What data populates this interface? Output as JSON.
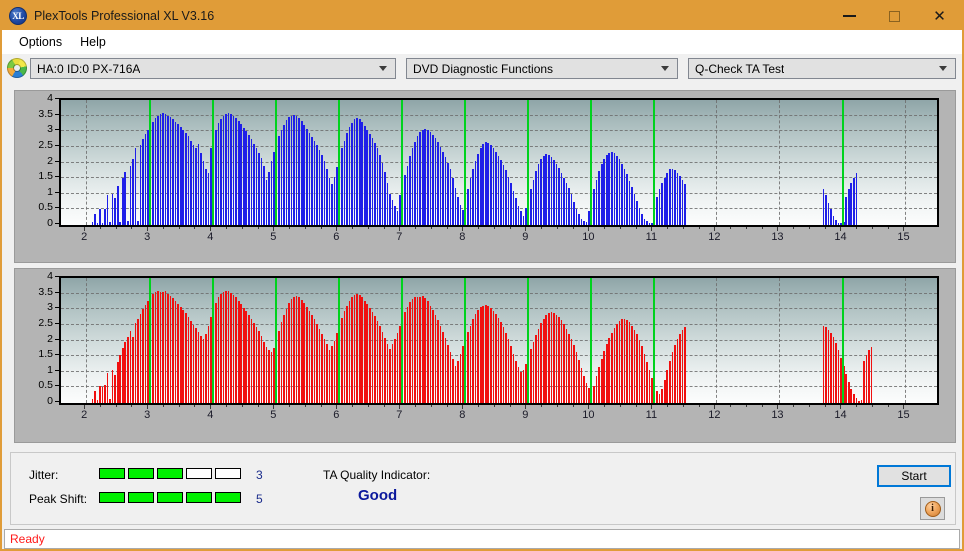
{
  "window": {
    "title": "PlexTools Professional XL V3.16",
    "app_icon": "xl-logo-icon",
    "minimize_label": "Minimize",
    "maximize_label": "Maximize",
    "close_label": "Close",
    "close_glyph": "✕"
  },
  "menubar": {
    "items": [
      {
        "label": "Options"
      },
      {
        "label": "Help"
      }
    ]
  },
  "toolbar": {
    "drive_icon": "optical-disc-icon",
    "drive_combo": {
      "value": "HA:0 ID:0  PX-716A",
      "options": [
        "HA:0 ID:0  PX-716A"
      ]
    },
    "function_combo": {
      "value": "DVD Diagnostic Functions",
      "options": [
        "DVD Diagnostic Functions"
      ]
    },
    "test_combo": {
      "value": "Q-Check TA Test",
      "options": [
        "Q-Check TA Test"
      ]
    }
  },
  "results": {
    "jitter_label": "Jitter:",
    "jitter_value": "3",
    "jitter_filled": 3,
    "jitter_total": 5,
    "peak_shift_label": "Peak Shift:",
    "peak_shift_value": "5",
    "peak_shift_filled": 5,
    "peak_shift_total": 5,
    "ta_quality_label": "TA Quality Indicator:",
    "ta_quality_value": "Good",
    "ta_quality_color": "#0b189c",
    "meter_on_color": "#00f000",
    "start_label": "Start",
    "info_icon": "info-icon"
  },
  "statusbar": {
    "text": "Ready",
    "color": "#ff1a1a"
  },
  "chart_data": [
    {
      "id": "jitter-chart",
      "type": "bar",
      "title": "",
      "xlabel": "",
      "ylabel": "",
      "color": "#1f1fe8",
      "xlim": [
        1.6,
        15.5
      ],
      "ylim": [
        0,
        4
      ],
      "yticks": [
        0,
        0.5,
        1,
        1.5,
        2,
        2.5,
        3,
        3.5,
        4
      ],
      "ytick_labels": [
        "0",
        "0.5",
        "1",
        "1.5",
        "2",
        "2.5",
        "3",
        "3.5",
        "4"
      ],
      "xticks": [
        2,
        3,
        4,
        5,
        6,
        7,
        8,
        9,
        10,
        11,
        12,
        13,
        14,
        15
      ],
      "xtick_labels": [
        "2",
        "3",
        "4",
        "5",
        "6",
        "7",
        "8",
        "9",
        "10",
        "11",
        "12",
        "13",
        "14",
        "15"
      ],
      "grid": true,
      "markers": [
        3,
        4,
        5,
        6,
        7,
        8,
        9,
        10,
        11,
        14
      ],
      "marker_color": "#00d21e",
      "x": [
        2.1,
        2.14,
        2.18,
        2.22,
        2.26,
        2.3,
        2.34,
        2.38,
        2.42,
        2.46,
        2.5,
        2.54,
        2.58,
        2.62,
        2.66,
        2.7,
        2.74,
        2.78,
        2.82,
        2.86,
        2.9,
        2.94,
        2.98,
        3.02,
        3.06,
        3.1,
        3.14,
        3.18,
        3.22,
        3.26,
        3.3,
        3.34,
        3.38,
        3.42,
        3.46,
        3.5,
        3.54,
        3.58,
        3.62,
        3.66,
        3.7,
        3.74,
        3.78,
        3.82,
        3.86,
        3.9,
        3.94,
        3.98,
        4.02,
        4.06,
        4.1,
        4.14,
        4.18,
        4.22,
        4.26,
        4.3,
        4.34,
        4.38,
        4.42,
        4.46,
        4.5,
        4.54,
        4.58,
        4.62,
        4.66,
        4.7,
        4.74,
        4.78,
        4.82,
        4.86,
        4.9,
        4.94,
        4.98,
        5.02,
        5.06,
        5.1,
        5.14,
        5.18,
        5.22,
        5.26,
        5.3,
        5.34,
        5.38,
        5.42,
        5.46,
        5.5,
        5.54,
        5.58,
        5.62,
        5.66,
        5.7,
        5.74,
        5.78,
        5.82,
        5.86,
        5.9,
        5.94,
        5.98,
        6.02,
        6.06,
        6.1,
        6.14,
        6.18,
        6.22,
        6.26,
        6.3,
        6.34,
        6.38,
        6.42,
        6.46,
        6.5,
        6.54,
        6.58,
        6.62,
        6.66,
        6.7,
        6.74,
        6.78,
        6.82,
        6.86,
        6.9,
        6.94,
        6.98,
        7.02,
        7.06,
        7.1,
        7.14,
        7.18,
        7.22,
        7.26,
        7.3,
        7.34,
        7.38,
        7.42,
        7.46,
        7.5,
        7.54,
        7.58,
        7.62,
        7.66,
        7.7,
        7.74,
        7.78,
        7.82,
        7.86,
        7.9,
        7.94,
        7.98,
        8.02,
        8.06,
        8.1,
        8.14,
        8.18,
        8.22,
        8.26,
        8.3,
        8.34,
        8.38,
        8.42,
        8.46,
        8.5,
        8.54,
        8.58,
        8.62,
        8.66,
        8.7,
        8.74,
        8.78,
        8.82,
        8.86,
        8.9,
        8.94,
        8.98,
        9.02,
        9.06,
        9.1,
        9.14,
        9.18,
        9.22,
        9.26,
        9.3,
        9.34,
        9.38,
        9.42,
        9.46,
        9.5,
        9.54,
        9.58,
        9.62,
        9.66,
        9.7,
        9.74,
        9.78,
        9.82,
        9.86,
        9.9,
        9.94,
        9.98,
        10.02,
        10.06,
        10.1,
        10.14,
        10.18,
        10.22,
        10.26,
        10.3,
        10.34,
        10.38,
        10.42,
        10.46,
        10.5,
        10.54,
        10.58,
        10.62,
        10.66,
        10.7,
        10.74,
        10.78,
        10.82,
        10.86,
        10.9,
        10.94,
        10.98,
        11.02,
        11.06,
        11.1,
        11.14,
        11.18,
        11.22,
        11.26,
        11.3,
        11.34,
        11.38,
        11.42,
        11.46,
        11.5,
        13.7,
        13.74,
        13.78,
        13.82,
        13.86,
        13.9,
        13.94,
        13.98,
        14.02,
        14.06,
        14.1,
        14.14,
        14.18,
        14.22
      ],
      "values": [
        0.1,
        0.35,
        0.08,
        0.52,
        0.06,
        0.5,
        0.95,
        0.1,
        1.0,
        0.85,
        1.25,
        0.1,
        1.5,
        1.7,
        0.12,
        1.9,
        2.1,
        2.45,
        0.12,
        2.55,
        2.75,
        2.9,
        3.05,
        3.2,
        3.3,
        3.42,
        3.5,
        3.56,
        3.57,
        3.55,
        3.5,
        3.45,
        3.38,
        3.3,
        3.22,
        3.15,
        3.05,
        2.95,
        2.85,
        2.7,
        2.55,
        2.45,
        2.6,
        2.3,
        2.05,
        1.8,
        1.65,
        2.45,
        2.8,
        3.05,
        3.25,
        3.4,
        3.5,
        3.55,
        3.58,
        3.56,
        3.5,
        3.42,
        3.32,
        3.22,
        3.1,
        3.0,
        2.88,
        2.75,
        2.6,
        2.45,
        2.3,
        2.15,
        1.9,
        1.45,
        1.7,
        2.05,
        2.35,
        2.6,
        2.85,
        3.05,
        3.2,
        3.35,
        3.45,
        3.5,
        3.52,
        3.48,
        3.42,
        3.32,
        3.2,
        3.08,
        2.95,
        2.82,
        2.68,
        2.55,
        2.4,
        2.25,
        2.05,
        1.8,
        1.5,
        1.3,
        1.55,
        1.85,
        2.15,
        2.45,
        2.7,
        2.95,
        3.15,
        3.28,
        3.38,
        3.42,
        3.38,
        3.3,
        3.18,
        3.05,
        2.92,
        2.78,
        2.62,
        2.45,
        2.25,
        2.0,
        1.7,
        1.35,
        1.0,
        0.8,
        0.6,
        0.45,
        0.95,
        1.25,
        1.6,
        1.9,
        2.2,
        2.45,
        2.65,
        2.85,
        2.98,
        3.05,
        3.08,
        3.05,
        2.98,
        2.88,
        2.78,
        2.65,
        2.5,
        2.35,
        2.18,
        2.0,
        1.78,
        1.5,
        1.2,
        0.9,
        0.65,
        0.48,
        0.85,
        1.15,
        1.5,
        1.8,
        2.05,
        2.28,
        2.45,
        2.58,
        2.65,
        2.62,
        2.55,
        2.45,
        2.35,
        2.22,
        2.08,
        1.92,
        1.75,
        1.55,
        1.35,
        1.1,
        0.85,
        0.62,
        0.45,
        0.3,
        0.55,
        0.85,
        1.15,
        1.45,
        1.72,
        1.95,
        2.12,
        2.22,
        2.28,
        2.25,
        2.18,
        2.08,
        1.95,
        1.82,
        1.68,
        1.52,
        1.35,
        1.18,
        0.98,
        0.75,
        0.52,
        0.35,
        0.2,
        0.12,
        0.1,
        0.45,
        0.8,
        1.15,
        1.45,
        1.72,
        1.95,
        2.12,
        2.25,
        2.32,
        2.35,
        2.3,
        2.22,
        2.1,
        1.95,
        1.8,
        1.62,
        1.42,
        1.22,
        1.0,
        0.78,
        0.55,
        0.35,
        0.2,
        0.12,
        0.08,
        0.06,
        0.05,
        0.9,
        1.15,
        1.35,
        1.52,
        1.68,
        1.78,
        1.8,
        1.75,
        1.68,
        1.58,
        1.45,
        1.3,
        1.15,
        0.95,
        0.72,
        0.5,
        0.3,
        0.15,
        0.08,
        0.05,
        0.1,
        0.9,
        1.15,
        1.35,
        1.52,
        1.65,
        1.75,
        1.8,
        1.78,
        1.7,
        1.58,
        1.42,
        1.2,
        0.95,
        0.7
      ]
    },
    {
      "id": "peak-shift-chart",
      "type": "bar",
      "title": "",
      "xlabel": "",
      "ylabel": "",
      "color": "#f01010",
      "xlim": [
        1.6,
        15.5
      ],
      "ylim": [
        0,
        4
      ],
      "yticks": [
        0,
        0.5,
        1,
        1.5,
        2,
        2.5,
        3,
        3.5,
        4
      ],
      "ytick_labels": [
        "0",
        "0.5",
        "1",
        "1.5",
        "2",
        "2.5",
        "3",
        "3.5",
        "4"
      ],
      "xticks": [
        2,
        3,
        4,
        5,
        6,
        7,
        8,
        9,
        10,
        11,
        12,
        13,
        14,
        15
      ],
      "xtick_labels": [
        "2",
        "3",
        "4",
        "5",
        "6",
        "7",
        "8",
        "9",
        "10",
        "11",
        "12",
        "13",
        "14",
        "15"
      ],
      "grid": true,
      "markers": [
        3,
        4,
        5,
        6,
        7,
        8,
        9,
        10,
        11,
        14
      ],
      "marker_color": "#00d21e",
      "x": [
        2.1,
        2.14,
        2.18,
        2.22,
        2.26,
        2.3,
        2.34,
        2.38,
        2.42,
        2.46,
        2.5,
        2.54,
        2.58,
        2.62,
        2.66,
        2.7,
        2.74,
        2.78,
        2.82,
        2.86,
        2.9,
        2.94,
        2.98,
        3.02,
        3.06,
        3.1,
        3.14,
        3.18,
        3.22,
        3.26,
        3.3,
        3.34,
        3.38,
        3.42,
        3.46,
        3.5,
        3.54,
        3.58,
        3.62,
        3.66,
        3.7,
        3.74,
        3.78,
        3.82,
        3.86,
        3.9,
        3.94,
        3.98,
        4.02,
        4.06,
        4.1,
        4.14,
        4.18,
        4.22,
        4.26,
        4.3,
        4.34,
        4.38,
        4.42,
        4.46,
        4.5,
        4.54,
        4.58,
        4.62,
        4.66,
        4.7,
        4.74,
        4.78,
        4.82,
        4.86,
        4.9,
        4.94,
        4.98,
        5.02,
        5.06,
        5.1,
        5.14,
        5.18,
        5.22,
        5.26,
        5.3,
        5.34,
        5.38,
        5.42,
        5.46,
        5.5,
        5.54,
        5.58,
        5.62,
        5.66,
        5.7,
        5.74,
        5.78,
        5.82,
        5.86,
        5.9,
        5.94,
        5.98,
        6.02,
        6.06,
        6.1,
        6.14,
        6.18,
        6.22,
        6.26,
        6.3,
        6.34,
        6.38,
        6.42,
        6.46,
        6.5,
        6.54,
        6.58,
        6.62,
        6.66,
        6.7,
        6.74,
        6.78,
        6.82,
        6.86,
        6.9,
        6.94,
        6.98,
        7.02,
        7.06,
        7.1,
        7.14,
        7.18,
        7.22,
        7.26,
        7.3,
        7.34,
        7.38,
        7.42,
        7.46,
        7.5,
        7.54,
        7.58,
        7.62,
        7.66,
        7.7,
        7.74,
        7.78,
        7.82,
        7.86,
        7.9,
        7.94,
        7.98,
        8.02,
        8.06,
        8.1,
        8.14,
        8.18,
        8.22,
        8.26,
        8.3,
        8.34,
        8.38,
        8.42,
        8.46,
        8.5,
        8.54,
        8.58,
        8.62,
        8.66,
        8.7,
        8.74,
        8.78,
        8.82,
        8.86,
        8.9,
        8.94,
        8.98,
        9.02,
        9.06,
        9.1,
        9.14,
        9.18,
        9.22,
        9.26,
        9.3,
        9.34,
        9.38,
        9.42,
        9.46,
        9.5,
        9.54,
        9.58,
        9.62,
        9.66,
        9.7,
        9.74,
        9.78,
        9.82,
        9.86,
        9.9,
        9.94,
        9.98,
        10.02,
        10.06,
        10.1,
        10.14,
        10.18,
        10.22,
        10.26,
        10.3,
        10.34,
        10.38,
        10.42,
        10.46,
        10.5,
        10.54,
        10.58,
        10.62,
        10.66,
        10.7,
        10.74,
        10.78,
        10.82,
        10.86,
        10.9,
        10.94,
        10.98,
        11.02,
        11.06,
        11.1,
        11.14,
        11.18,
        11.22,
        11.26,
        11.3,
        11.34,
        11.38,
        11.42,
        11.46,
        11.5,
        13.7,
        13.74,
        13.78,
        13.82,
        13.86,
        13.9,
        13.94,
        13.98,
        14.02,
        14.06,
        14.1,
        14.14,
        14.18,
        14.22,
        14.26,
        14.3,
        14.34,
        14.38,
        14.42,
        14.46
      ],
      "values": [
        0.12,
        0.38,
        0.1,
        0.55,
        0.52,
        0.58,
        0.95,
        0.12,
        1.05,
        0.9,
        1.3,
        1.55,
        1.75,
        1.95,
        2.1,
        2.3,
        2.1,
        2.55,
        2.7,
        2.85,
        3.0,
        3.15,
        3.28,
        3.38,
        3.48,
        3.54,
        3.58,
        3.56,
        3.55,
        3.58,
        3.5,
        3.42,
        3.35,
        3.25,
        3.18,
        3.08,
        2.98,
        2.88,
        2.75,
        2.62,
        2.5,
        2.4,
        2.28,
        2.15,
        2.05,
        2.2,
        2.45,
        2.75,
        3.0,
        3.2,
        3.38,
        3.48,
        3.55,
        3.58,
        3.57,
        3.52,
        3.45,
        3.38,
        3.28,
        3.18,
        3.05,
        2.95,
        2.82,
        2.7,
        2.55,
        2.42,
        2.3,
        2.15,
        1.95,
        1.8,
        1.7,
        1.62,
        1.75,
        2.05,
        2.32,
        2.58,
        2.82,
        3.02,
        3.2,
        3.32,
        3.4,
        3.42,
        3.38,
        3.3,
        3.2,
        3.08,
        2.95,
        2.82,
        2.68,
        2.52,
        2.38,
        2.22,
        2.05,
        1.88,
        1.7,
        1.82,
        2.0,
        2.25,
        2.5,
        2.72,
        2.95,
        3.12,
        3.28,
        3.38,
        3.45,
        3.48,
        3.45,
        3.38,
        3.28,
        3.18,
        3.05,
        2.92,
        2.78,
        2.62,
        2.45,
        2.28,
        2.08,
        1.88,
        1.72,
        1.88,
        2.05,
        2.25,
        2.48,
        2.7,
        2.9,
        3.08,
        3.22,
        3.32,
        3.38,
        3.4,
        3.38,
        3.42,
        3.35,
        3.25,
        3.12,
        2.98,
        2.82,
        2.65,
        2.48,
        2.28,
        2.08,
        1.85,
        1.62,
        1.4,
        1.2,
        1.35,
        1.58,
        1.82,
        2.05,
        2.28,
        2.48,
        2.68,
        2.85,
        2.98,
        3.08,
        3.12,
        3.15,
        3.12,
        3.05,
        2.95,
        2.85,
        2.72,
        2.58,
        2.42,
        2.25,
        2.05,
        1.82,
        1.58,
        1.35,
        1.15,
        0.98,
        1.05,
        1.25,
        1.48,
        1.72,
        1.95,
        2.18,
        2.38,
        2.55,
        2.7,
        2.82,
        2.88,
        2.9,
        2.88,
        2.82,
        2.75,
        2.65,
        2.52,
        2.38,
        2.22,
        2.05,
        1.85,
        1.62,
        1.38,
        1.12,
        0.88,
        0.65,
        0.48,
        0.35,
        0.55,
        0.85,
        1.15,
        1.42,
        1.68,
        1.9,
        2.08,
        2.25,
        2.4,
        2.52,
        2.62,
        2.68,
        2.7,
        2.66,
        2.58,
        2.48,
        2.35,
        2.2,
        2.02,
        1.82,
        1.58,
        1.32,
        1.05,
        0.8,
        0.58,
        0.4,
        0.28,
        0.45,
        0.75,
        1.05,
        1.35,
        1.62,
        1.85,
        2.05,
        2.22,
        2.35,
        2.42,
        2.45,
        2.42,
        2.35,
        2.25,
        2.1,
        1.92,
        1.7,
        1.45,
        1.18,
        0.92,
        0.68,
        0.45,
        0.28,
        0.15,
        0.08,
        0.1,
        1.35,
        1.55,
        1.7,
        1.8,
        1.72,
        1.62,
        1.7,
        1.6,
        1.45,
        1.3,
        1.12,
        0.92,
        0.72,
        0.95,
        0.52,
        0.35
      ]
    }
  ]
}
